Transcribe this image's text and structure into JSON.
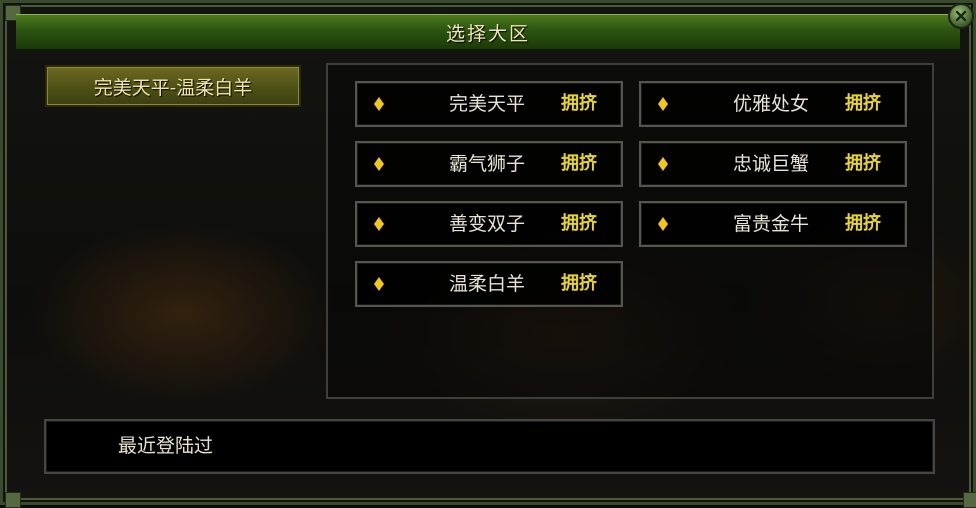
{
  "window": {
    "title": "选择大区",
    "close_icon": "close-x-icon"
  },
  "region_tab": {
    "label": "完美天平-温柔白羊",
    "selected": true
  },
  "servers": [
    {
      "name": "完美天平",
      "status": "拥挤"
    },
    {
      "name": "优雅处女",
      "status": "拥挤"
    },
    {
      "name": "霸气狮子",
      "status": "拥挤"
    },
    {
      "name": "忠诚巨蟹",
      "status": "拥挤"
    },
    {
      "name": "善变双子",
      "status": "拥挤"
    },
    {
      "name": "富贵金牛",
      "status": "拥挤"
    },
    {
      "name": "温柔白羊",
      "status": "拥挤"
    }
  ],
  "server_marker_icon": "yellow-diamond-icon",
  "recent": {
    "label": "最近登陆过"
  },
  "colors": {
    "title_bar": "#2c5410",
    "status_text": "#e8d52c",
    "diamond": "#f2c61a",
    "tab_bg": "#4e5114"
  }
}
